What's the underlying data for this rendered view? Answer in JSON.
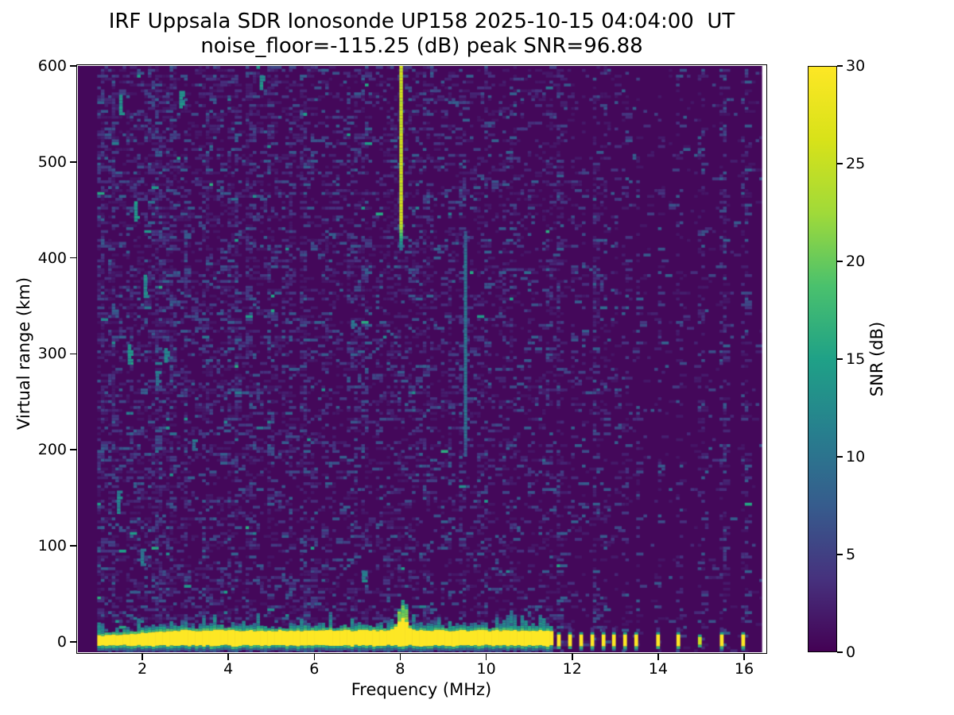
{
  "figure": {
    "title": "IRF Uppsala SDR Ionosonde UP158 2025-10-15 04:04:00  UT",
    "subtitle": "noise_floor=-115.25 (dB) peak SNR=96.88",
    "background_color": "#ffffff",
    "text_color": "#000000"
  },
  "chart_data": {
    "type": "heatmap",
    "title": "IRF Uppsala SDR Ionosonde UP158 2025-10-15 04:04:00  UT",
    "subtitle": "noise_floor=-115.25 (dB) peak SNR=96.88",
    "station": "UP158",
    "timestamp_ut": "2025-10-15 04:04:00",
    "noise_floor_db": -115.25,
    "peak_snr_db": 96.88,
    "xlabel": "Frequency (MHz)",
    "ylabel": "Virtual range (km)",
    "colorbar_label": "SNR (dB)",
    "colormap": "viridis",
    "xlim_mhz": [
      0.5,
      16.5
    ],
    "ylim_km": [
      -11,
      600
    ],
    "snr_scale_db": [
      0,
      30
    ],
    "xticks": [
      2,
      4,
      6,
      8,
      10,
      12,
      14,
      16
    ],
    "yticks": [
      0,
      100,
      200,
      300,
      400,
      500,
      600
    ],
    "cbar_ticks": [
      0,
      5,
      10,
      15,
      20,
      25,
      30
    ],
    "grid": false,
    "data_freq_range_mhz": [
      0.95,
      16.42
    ],
    "features": {
      "ground_return_band": {
        "freq_range_mhz": [
          0.95,
          11.55
        ],
        "center_km": 0,
        "snr_db": 30,
        "core_top_km": [
          5,
          11
        ],
        "core_bottom_km": -5,
        "fringe": "teal-green mottled edge above and below"
      },
      "tx_plume": {
        "freq_mhz": 8.02,
        "top_km": 32,
        "snr_db": 22
      },
      "ground_spurs_mhz": [
        11.69,
        11.95,
        12.21,
        12.47,
        12.73,
        12.97,
        13.23,
        13.49,
        14.0,
        14.47,
        14.97,
        15.48,
        15.98
      ],
      "weak_spur_mhz": 14.97,
      "vertical_traces": [
        {
          "freq_mhz": 8.02,
          "range_km": [
            410,
            600
          ],
          "snr_db": 25
        },
        {
          "freq_mhz": 9.52,
          "range_km": [
            195,
            428
          ],
          "snr_db": 10
        }
      ],
      "echo_patches": [
        {
          "f": 1.5,
          "km": 560,
          "len": 20,
          "v": 0.5
        },
        {
          "f": 2.9,
          "km": 565,
          "len": 18,
          "v": 0.5
        },
        {
          "f": 4.77,
          "km": 583,
          "len": 14,
          "v": 0.5
        },
        {
          "f": 1.85,
          "km": 448,
          "len": 22,
          "v": 0.52
        },
        {
          "f": 2.07,
          "km": 370,
          "len": 25,
          "v": 0.45
        },
        {
          "f": 1.7,
          "km": 300,
          "len": 20,
          "v": 0.5
        },
        {
          "f": 2.55,
          "km": 298,
          "len": 16,
          "v": 0.48
        },
        {
          "f": 2.35,
          "km": 275,
          "len": 14,
          "v": 0.42
        },
        {
          "f": 1.45,
          "km": 145,
          "len": 25,
          "v": 0.45
        },
        {
          "f": 2.0,
          "km": 88,
          "len": 18,
          "v": 0.42
        },
        {
          "f": 7.15,
          "km": 68,
          "len": 12,
          "v": 0.45
        },
        {
          "f": 3.2,
          "km": 205,
          "len": 12,
          "v": 0.4
        },
        {
          "f": 6.9,
          "km": 330,
          "len": 10,
          "v": 0.38
        }
      ],
      "noise": {
        "background_db": 0.5,
        "speckle_density_below_3mhz": 0.42,
        "speckle_density_3_5mhz": 0.36,
        "speckle_density_5_8mhz": 0.3,
        "speckle_density_8_11mhz": 0.27,
        "speckle_density_spur_columns": 0.32,
        "speckle_density_quiet_high_freq": 0.04,
        "teal_speckle_fraction_low_freq": 0.018
      }
    }
  },
  "colorbar": {
    "min_label": "0",
    "max_label": "30"
  }
}
